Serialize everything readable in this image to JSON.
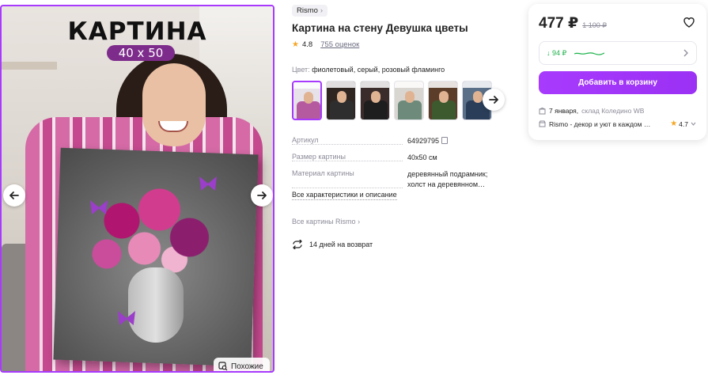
{
  "gallery": {
    "poster_title": "КАРТИНА",
    "poster_size": "40 х 50",
    "similar_label": "Похожие"
  },
  "product": {
    "brand": "Rismo",
    "title": "Картина на стену Девушка цветы",
    "rating": "4.8",
    "reviews": "755 оценок",
    "color_label": "Цвет:",
    "color_value": "фиолетовый, серый, розовый фламинго",
    "thumbnails": [
      "variant-1",
      "variant-2",
      "variant-3",
      "variant-4",
      "variant-5",
      "variant-6"
    ],
    "specs": [
      {
        "key": "Артикул",
        "value": "64929795"
      },
      {
        "key": "Размер картины",
        "value": "40x50 см"
      },
      {
        "key": "Материал картины",
        "value": "деревянный подрамник; холст на деревянном…"
      }
    ],
    "all_characteristics": "Все характеристики и описание",
    "all_brand_items": "Все картины Rismo",
    "returns": "14 дней на возврат"
  },
  "buy_card": {
    "price": "477 ₽",
    "old_price": "1 100 ₽",
    "wallet_discount": "↓ 94 ₽",
    "add_to_cart": "Добавить в корзину",
    "delivery_date": "7 января,",
    "delivery_warehouse": "склад Коледино WB",
    "seller_name": "Rismo - декор и уют в каждом …",
    "seller_rating": "4.7"
  },
  "colors": {
    "accent": "#a73afd",
    "wallet_green": "#1ab248",
    "star": "#f5a623"
  }
}
